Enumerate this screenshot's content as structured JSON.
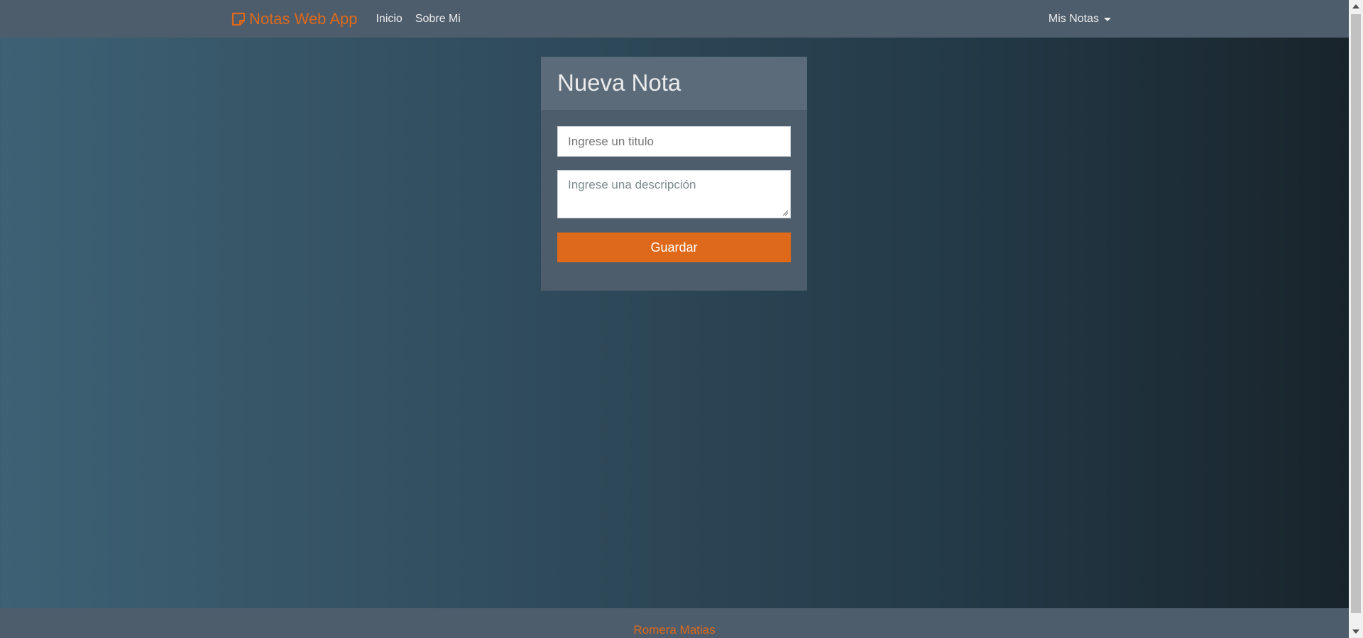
{
  "navbar": {
    "brand": "Notas Web App",
    "links": [
      "Inicio",
      "Sobre Mi"
    ],
    "dropdown": "Mis Notas"
  },
  "card": {
    "title": "Nueva Nota",
    "title_placeholder": "Ingrese un titulo",
    "description_placeholder": "Ingrese una descripción",
    "save_label": "Guardar"
  },
  "footer": {
    "text": "Romera Matias"
  },
  "colors": {
    "accent": "#df691a",
    "navbar": "#4e5d6c",
    "card_header": "#5c6b7a"
  },
  "icons": {
    "brand_icon": "sticky-note-icon"
  }
}
